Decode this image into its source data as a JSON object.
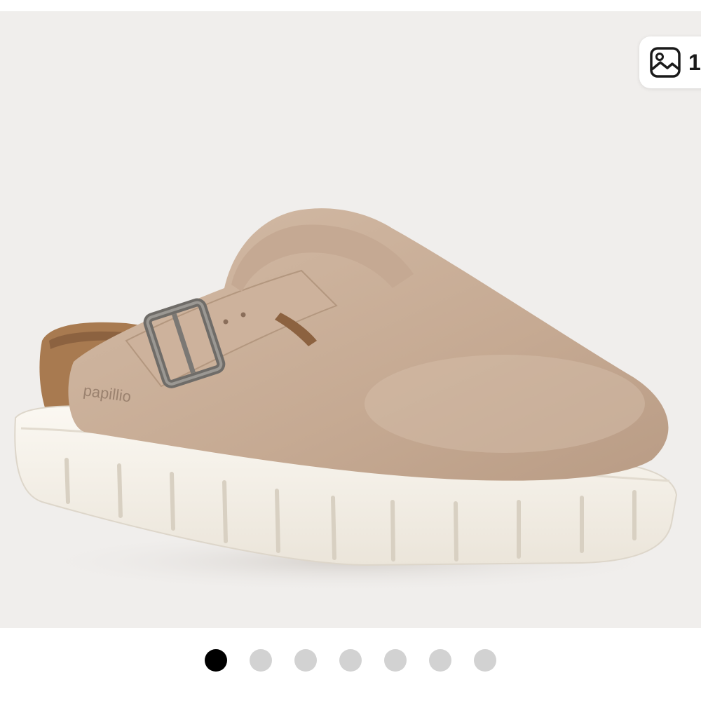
{
  "gallery": {
    "image_alt": "papillio",
    "brand_imprint": "papillio",
    "photo_count": "1",
    "counter_icon": "image-icon",
    "total_slides": 7,
    "active_slide": 1,
    "colors": {
      "background": "#f0eeec",
      "suede": "#c9ae98",
      "sole": "#f6f2ea",
      "cork": "#a87a50",
      "dot_active": "#000000",
      "dot_inactive": "#d2d2d2"
    }
  }
}
